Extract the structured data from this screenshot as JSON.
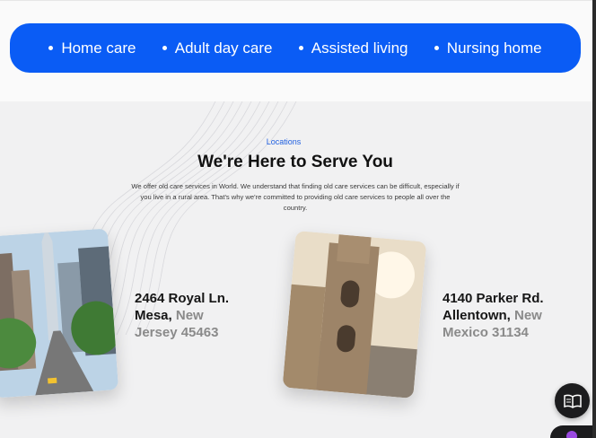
{
  "services": {
    "items": [
      {
        "label": "Home care"
      },
      {
        "label": "Adult day care"
      },
      {
        "label": "Assisted living"
      },
      {
        "label": "Nursing home"
      }
    ],
    "pill_color": "#0a5cf5"
  },
  "locations": {
    "eyebrow": "Locations",
    "title": "We're Here to Serve You",
    "description": "We offer old care services in World. We understand that finding old care services can be difficult, especially if you live in a rural area. That's why we're committed to providing old care services to people all over the country.",
    "cards": [
      {
        "line1": "2464 Royal Ln.",
        "line2_dark": "Mesa,",
        "line2_grey": "New",
        "line3_grey": "Jersey 45463",
        "image": "city-street-photo"
      },
      {
        "line1": "4140 Parker Rd.",
        "line2_dark": "Allentown,",
        "line2_grey": "New",
        "line3_grey": "Mexico 31134",
        "image": "cathedral-tower-photo"
      }
    ]
  },
  "widgets": {
    "reader_icon": "book-open-icon"
  }
}
